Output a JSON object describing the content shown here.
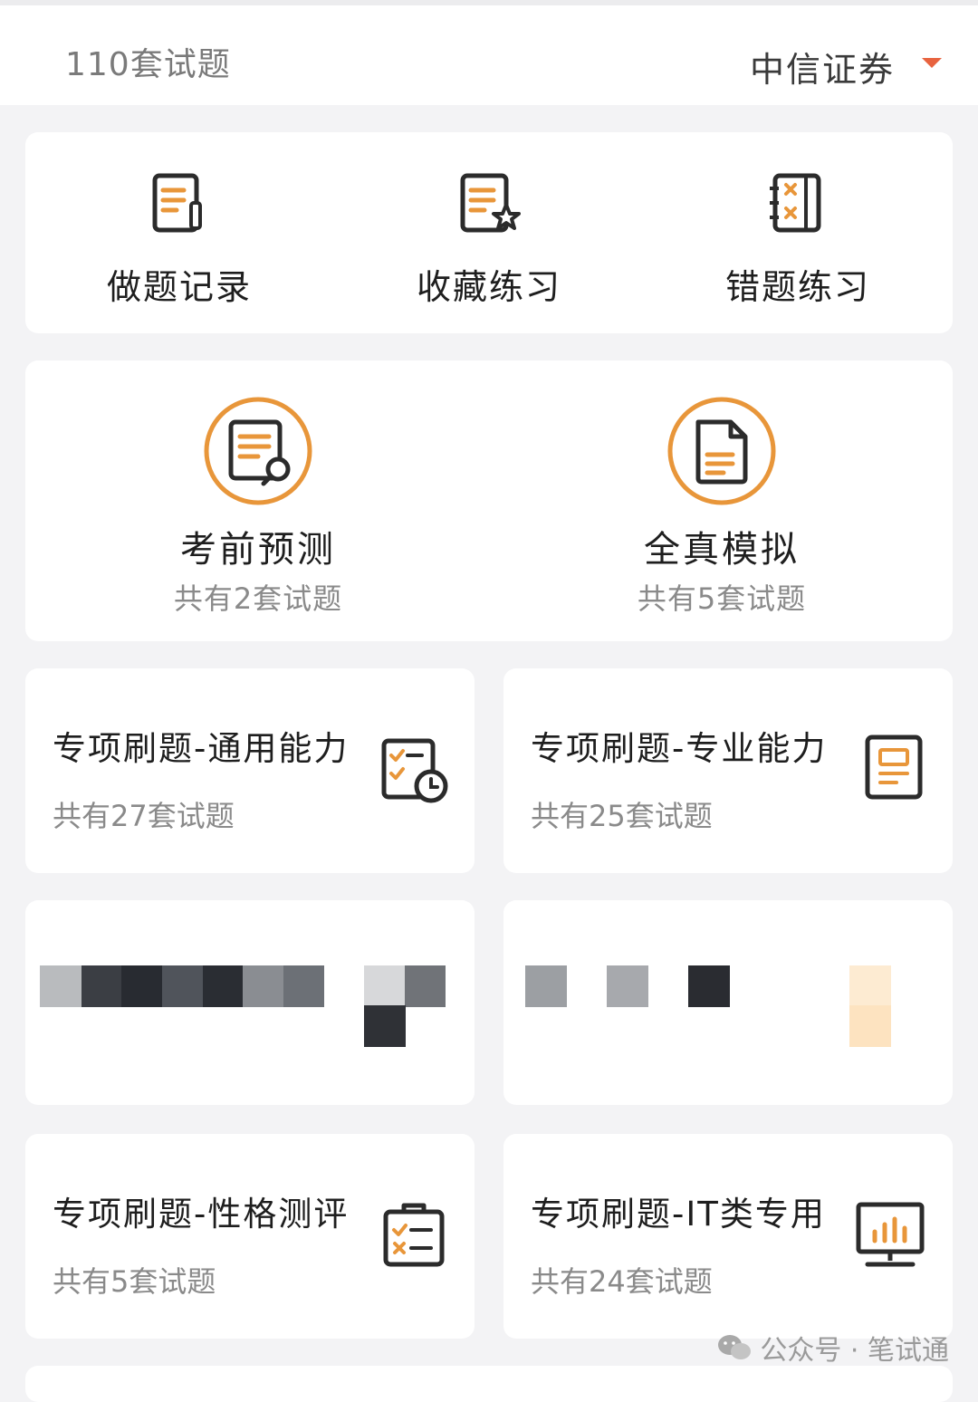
{
  "header": {
    "set_count": "110套试题",
    "company": "中信证券"
  },
  "tools": [
    {
      "label": "做题记录",
      "icon": "record-icon"
    },
    {
      "label": "收藏练习",
      "icon": "favorite-icon"
    },
    {
      "label": "错题练习",
      "icon": "wrong-questions-icon"
    }
  ],
  "featured": [
    {
      "label": "考前预测",
      "sub": "共有2套试题",
      "icon": "search-document-icon"
    },
    {
      "label": "全真模拟",
      "sub": "共有5套试题",
      "icon": "document-icon"
    }
  ],
  "tiles": [
    {
      "title": "专项刷题-通用能力",
      "sub": "共有27套试题",
      "icon": "checklist-clock-icon"
    },
    {
      "title": "专项刷题-专业能力",
      "sub": "共有25套试题",
      "icon": "book-icon"
    },
    {
      "title": "专项刷题-性格测评",
      "sub": "共有5套试题",
      "icon": "clipboard-check-icon"
    },
    {
      "title": "专项刷题-IT类专用",
      "sub": "共有24套试题",
      "icon": "monitor-chart-icon"
    }
  ],
  "watermark": {
    "text": "公众号 · 笔试通",
    "icon": "wechat-icon"
  },
  "colors": {
    "accent": "#e8963a",
    "caret": "#e8633f",
    "icon_dark": "#2b2b2b"
  }
}
